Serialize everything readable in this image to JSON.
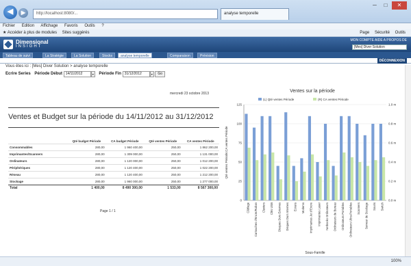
{
  "browser": {
    "url": "http://localhost:8080/...",
    "tab_title": "analyse temporelle",
    "menu": [
      "Fichier",
      "Edition",
      "Affichage",
      "Favoris",
      "Outils",
      "?"
    ],
    "favorites": [
      "Accéder à plus de modules",
      "Sites suggérés"
    ],
    "toolbar_right": [
      "Page",
      "Sécurité",
      "Outils"
    ],
    "zoom": "100%"
  },
  "app": {
    "logo_line1": "Dimensional",
    "logo_line2": "INSIGHT",
    "header_links": "MON COMPTE  AIDE  A PROPOS DE",
    "selector": "[Mes] Diver Solution",
    "tabs": [
      "Tableau de suivi",
      "La Stratégie",
      "La Solution",
      "Stocks",
      "analyse temporelle",
      "Comparaison",
      "Prévision"
    ],
    "disconnect": "DÉCONNEXION",
    "breadcrumb": "Vous êtes ici : [Mes] Diver Solution > analyse temporelle"
  },
  "filters": {
    "series_label": "Ecrire Series",
    "start_label": "Période Début",
    "start_value": "14/11/2012",
    "end_label": "Période Fin",
    "end_value": "31/12/2012",
    "ok": "Go"
  },
  "report": {
    "date": "mercredi 23 octobre 2013",
    "title": "Ventes et Budget sur la période du 14/11/2012 au 31/12/2012",
    "columns": [
      "",
      "Qté budget Période",
      "CA budget Période",
      "Qté ventes Période",
      "CA ventes Période"
    ],
    "rows": [
      [
        "Consommables",
        "280,00",
        "1 960 400,00",
        "250,00",
        "1 862 200,00"
      ],
      [
        "Imprimantes/Scanners",
        "280,00",
        "1 309 000,00",
        "250,00",
        "1 131 000,00"
      ],
      [
        "Ordinateurs",
        "280,00",
        "1 120 000,00",
        "250,00",
        "1 012 200,00"
      ],
      [
        "Périphériques",
        "280,00",
        "1 120 400,00",
        "250,00",
        "1 022 200,00"
      ],
      [
        "Réseau",
        "280,00",
        "1 120 400,00",
        "250,00",
        "1 212 200,00"
      ],
      [
        "Stockage",
        "280,00",
        "1 960 000,00",
        "250,00",
        "1 277 000,00"
      ]
    ],
    "total": [
      "Total",
      "1 400,00",
      "8 490 300,00",
      "1 533,00",
      "8 567 300,00"
    ],
    "pager": "Page 1 / 1"
  },
  "chart_data": {
    "type": "bar",
    "title": "Ventes sur la période",
    "legend": [
      "(L) Qté ventes Période",
      "(R) CA ventes Période"
    ],
    "legend_colors": [
      "#7b9fd6",
      "#c8e6a8"
    ],
    "ylabel": "Qté ventes Période;CA ventes Période",
    "xlabel": "Sous-Famille",
    "left_ylim": [
      0,
      125
    ],
    "left_ticks": [
      "0",
      "25",
      "50",
      "75",
      "100",
      "125"
    ],
    "right_ylim": [
      0,
      1.0
    ],
    "right_ticks": [
      "0.0 m",
      "0.2 m",
      "0.4 m",
      "0.6 m",
      "0.8 m",
      "1.0 m"
    ],
    "categories": [
      "Câblage",
      "Cartouches d'Encre/Ruban",
      "Claviers",
      "Clés USB",
      "Disques Durs Externes",
      "Disques Durs Internes",
      "Ecrans",
      "Modems",
      "Imprimantes Jet d'Encre",
      "Imprimantes Laser",
      "Netbooks Ordinateurs",
      "Ordinateurs de Bureau",
      "Ordinateurs Portables",
      "Ordinateurs Ultra-Portables",
      "Scanners",
      "Serveur de Stockage",
      "Souris",
      "Switch"
    ],
    "series": [
      {
        "name": "(L) Qté ventes Période",
        "values": [
          113,
          95,
          110,
          110,
          45,
          115,
          45,
          55,
          110,
          50,
          100,
          45,
          110,
          110,
          100,
          85,
          100,
          100
        ]
      },
      {
        "name": "(R) CA ventes Période",
        "values": [
          0.55,
          0.42,
          0.48,
          0.5,
          0.22,
          0.47,
          0.2,
          0.3,
          0.48,
          0.25,
          0.42,
          0.26,
          0.5,
          0.45,
          0.4,
          0.36,
          0.42,
          0.45
        ]
      }
    ]
  }
}
